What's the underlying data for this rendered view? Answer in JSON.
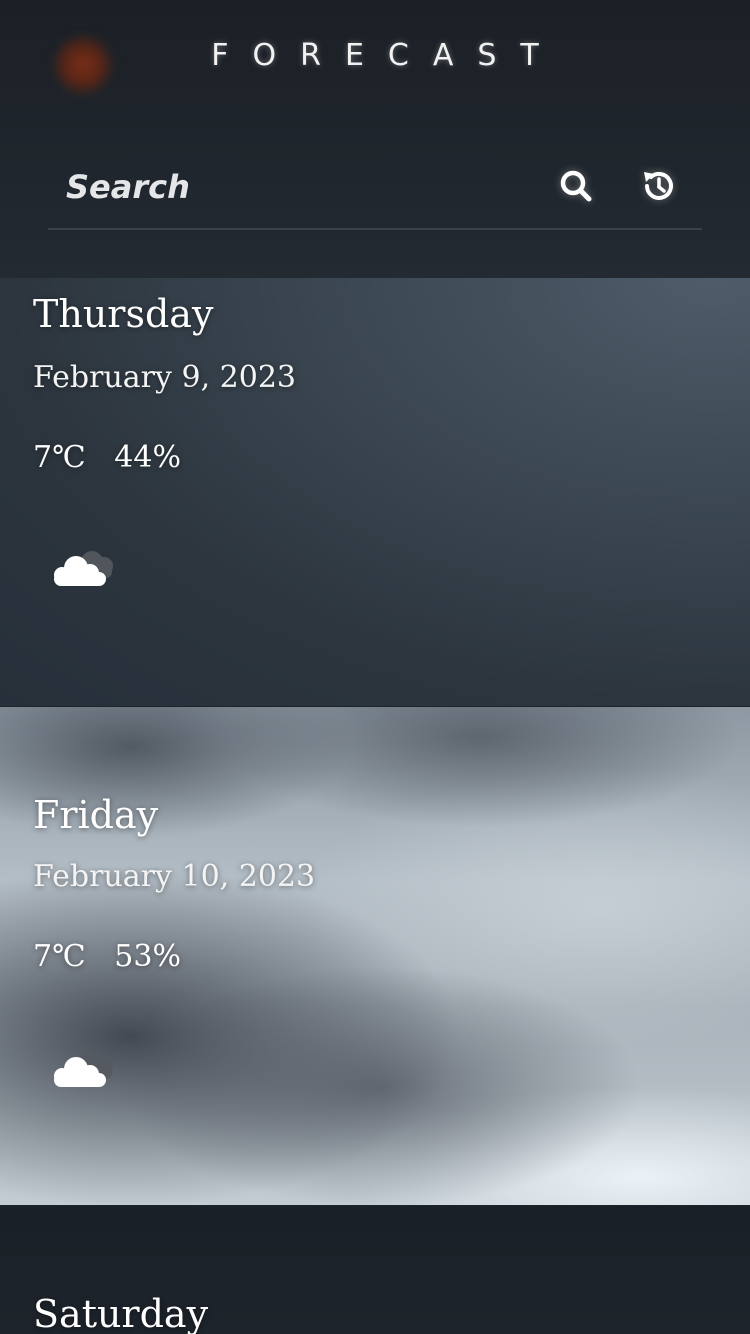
{
  "header": {
    "title": "FORECAST",
    "logo_icon": "orange-blob-logo-icon"
  },
  "search": {
    "placeholder": "Search",
    "value": "",
    "search_icon": "search-icon",
    "history_icon": "history-icon"
  },
  "forecast": [
    {
      "day": "Thursday",
      "date": "February 9, 2023",
      "temperature": "7℃",
      "humidity": "44%",
      "icon": "cloudy-icon"
    },
    {
      "day": "Friday",
      "date": "February 10, 2023",
      "temperature": "7℃",
      "humidity": "53%",
      "icon": "cloudy-icon"
    },
    {
      "day": "Saturday"
    }
  ],
  "colors": {
    "background": "#1c232a",
    "text": "#ffffff",
    "accent_logo": "#7a2e18"
  }
}
